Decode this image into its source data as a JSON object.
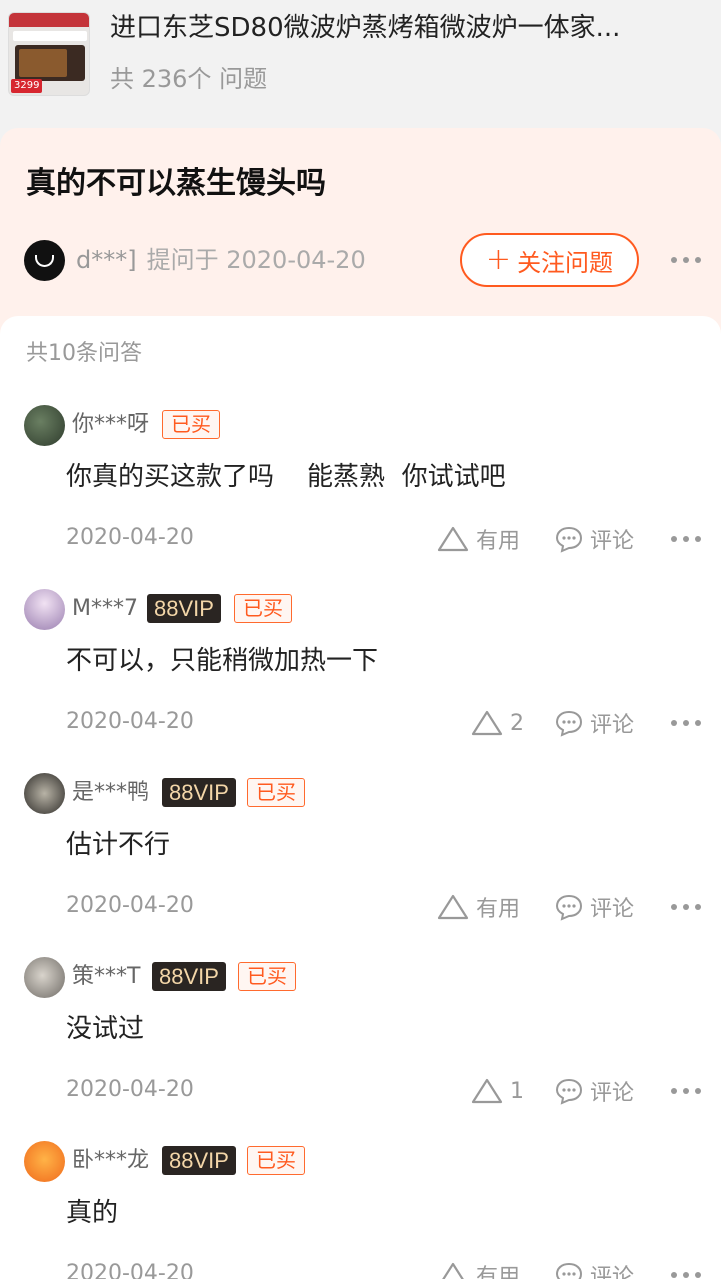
{
  "product": {
    "title": "进口东芝SD80微波炉蒸烤箱微波炉一体家...",
    "question_count": "共 236个 问题",
    "thumb_price": "3299"
  },
  "question": {
    "title": "真的不可以蒸生馒头吗",
    "asker": "d***]",
    "asked_at": "提问于 2020-04-20",
    "follow_label": "关注问题"
  },
  "answers_count": "共10条问答",
  "answers": [
    {
      "name": "你***呀",
      "vip": "",
      "bought": "已买",
      "text": "你真的买这款了吗    能蒸熟  你试试吧",
      "date": "2020-04-20",
      "useful": "有用",
      "comment": "评论"
    },
    {
      "name": "M***7",
      "vip": "88VIP",
      "bought": "已买",
      "text": "不可以，只能稍微加热一下",
      "date": "2020-04-20",
      "useful": "2",
      "comment": "评论"
    },
    {
      "name": "是***鸭",
      "vip": "88VIP",
      "bought": "已买",
      "text": "估计不行",
      "date": "2020-04-20",
      "useful": "有用",
      "comment": "评论"
    },
    {
      "name": "策***T",
      "vip": "88VIP",
      "bought": "已买",
      "text": "没试过",
      "date": "2020-04-20",
      "useful": "1",
      "comment": "评论"
    },
    {
      "name": "卧***龙",
      "vip": "88VIP",
      "bought": "已买",
      "text": "真的",
      "date": "2020-04-20",
      "useful": "有用",
      "comment": "评论"
    }
  ],
  "colors": {
    "accent": "#ff5a1f",
    "question_bg": "#fff1ec",
    "vip_bg": "#2a2522",
    "vip_text": "#f3d6a8"
  },
  "icons": [
    "plus-icon",
    "more-icon",
    "triangle-up-icon",
    "comment-bubble-icon"
  ]
}
